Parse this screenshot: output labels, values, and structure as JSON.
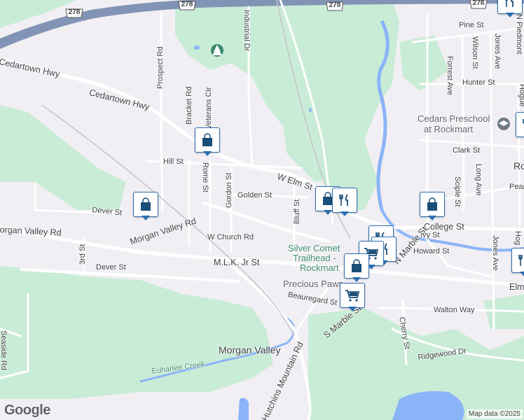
{
  "map": {
    "colors": {
      "land": "#f1eff3",
      "park": "#c9ecd6",
      "water": "#8ab4f8",
      "road": "#ffffff",
      "highway": "#8294b5",
      "marker_border": "#2d6fb0",
      "marker_icon": "#1c4f78"
    },
    "branding": "Google",
    "attribution": "Map data ©2025",
    "highway_shields": [
      "278",
      "278",
      "278",
      "278"
    ],
    "streets": {
      "pine": "Pine St",
      "piedmont": "N Piedmont",
      "jones_ave_n": "Jones Ave",
      "wilson": "Wilson St",
      "forrest": "Forrest Ave",
      "hunter": "Hunter St",
      "hogue": "Hogue",
      "prospect": "Prospect Rd",
      "industrial": "Industrial Dr",
      "cedartown_hwy_w": "Cedartown Hwy",
      "cedartown_hwy": "Cedartown Hwy",
      "bracket": "Bracket Rd",
      "veterans": "Veterans Cir",
      "clark": "Clark St",
      "long": "Long Ave",
      "sciple": "Sciple St",
      "hill": "Hill St",
      "rome": "Rome St",
      "w_elm": "W Elm St",
      "gordon": "Gordon St",
      "golden": "Golden St",
      "bluff": "Bluff St",
      "pearl": "Pear",
      "dever_w": "Dever St",
      "morgan_valley_rd": "Morgan Valley Rd",
      "morgan_valley_rd_w": "organ Valley Rd",
      "college": "College St",
      "ivy": "Ivy St",
      "n_marble": "N Marble St",
      "w_church": "W Church Rd",
      "howard": "Howard St",
      "jones_ave_s": "Jones Ave",
      "hogue_s": "Hog",
      "third": "3rd St",
      "dever": "Dever St",
      "mlk": "M.L.K. Jr St",
      "elm_e": "Elm",
      "beauregard": "Beauregard St",
      "walton": "Walton Way",
      "s_marble": "S Marble St",
      "cherry": "Cherry St",
      "ridgewood": "Ridgewood Dr",
      "seaside": "Seaside Rd",
      "hutchins": "Hutchins Mountain Rd",
      "rockmart_edge": "Ro"
    },
    "places": {
      "cedars_line1": "Cedars Preschool",
      "cedars_line2": "at Rockmart",
      "silver_comet_line1": "Silver Comet",
      "silver_comet_line2": "Trailhead -",
      "silver_comet_line3": "Rockmart",
      "precious_paws": "Precious Paws",
      "morgan_valley": "Morgan Valley",
      "euharlee_creek": "Euharlee Creek"
    },
    "markers": [
      {
        "icon": "shopping-bag-icon",
        "label": "Shopping"
      },
      {
        "icon": "shopping-bag-icon",
        "label": "Shopping"
      },
      {
        "icon": "shopping-bag-icon",
        "label": "Shopping"
      },
      {
        "icon": "shopping-bag-icon",
        "label": "Shopping"
      },
      {
        "icon": "restaurant-icon",
        "label": "Restaurant"
      },
      {
        "icon": "restaurant-icon",
        "label": "Restaurant"
      },
      {
        "icon": "restaurant-icon",
        "label": "Restaurant"
      },
      {
        "icon": "shopping-cart-icon",
        "label": "Grocery"
      },
      {
        "icon": "shopping-bag-icon",
        "label": "Shopping"
      },
      {
        "icon": "shopping-cart-icon",
        "label": "Grocery"
      },
      {
        "icon": "restaurant-icon",
        "label": "Restaurant"
      },
      {
        "icon": "restaurant-icon",
        "label": "Restaurant"
      },
      {
        "icon": "restaurant-icon",
        "label": "Restaurant"
      }
    ]
  }
}
